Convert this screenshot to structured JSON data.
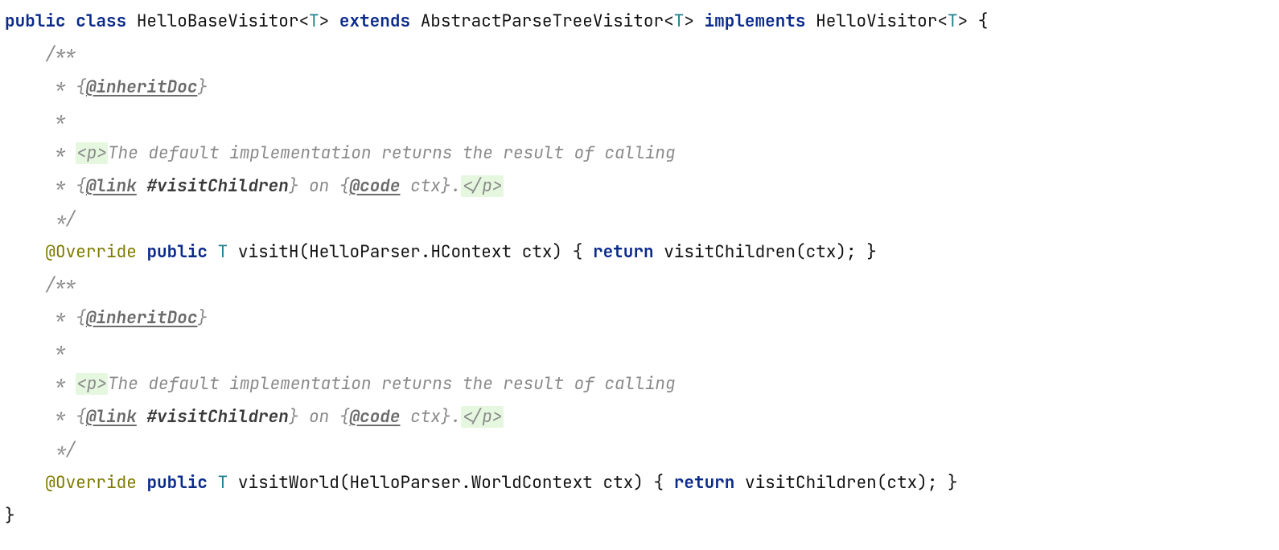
{
  "keywords": {
    "public": "public",
    "class": "class",
    "extends": "extends",
    "implements": "implements",
    "return": "return"
  },
  "types": {
    "T": "T"
  },
  "identifiers": {
    "className": "HelloBaseVisitor",
    "superclass": "AbstractParseTreeVisitor",
    "interface": "HelloVisitor",
    "annotation": "Override",
    "visitH": "visitH",
    "visitWorld": "visitWorld",
    "helloParser": "HelloParser",
    "hContext": "HContext",
    "worldContext": "WorldContext",
    "ctx": "ctx",
    "visitChildren": "visitChildren"
  },
  "javadoc": {
    "open": "/**",
    "close": " */",
    "star": " *",
    "starSpace": " * ",
    "openBrace": "{",
    "closeBrace": "}",
    "at": "@",
    "inheritDoc": "inheritDoc",
    "link": "link",
    "code": "code",
    "pOpen": "<p>",
    "pClose": "</p>",
    "hashVisitChildren": "#visitChildren",
    "desc1": "The default implementation returns the result of calling",
    "on": " on ",
    "ctx": " ctx",
    "period": "."
  },
  "punct": {
    "lt": "<",
    "gt": ">",
    "lb": "{",
    "rb": "}",
    "lp": "(",
    "rp": ")",
    "semi": ";",
    "dot": ".",
    "sp": " "
  }
}
